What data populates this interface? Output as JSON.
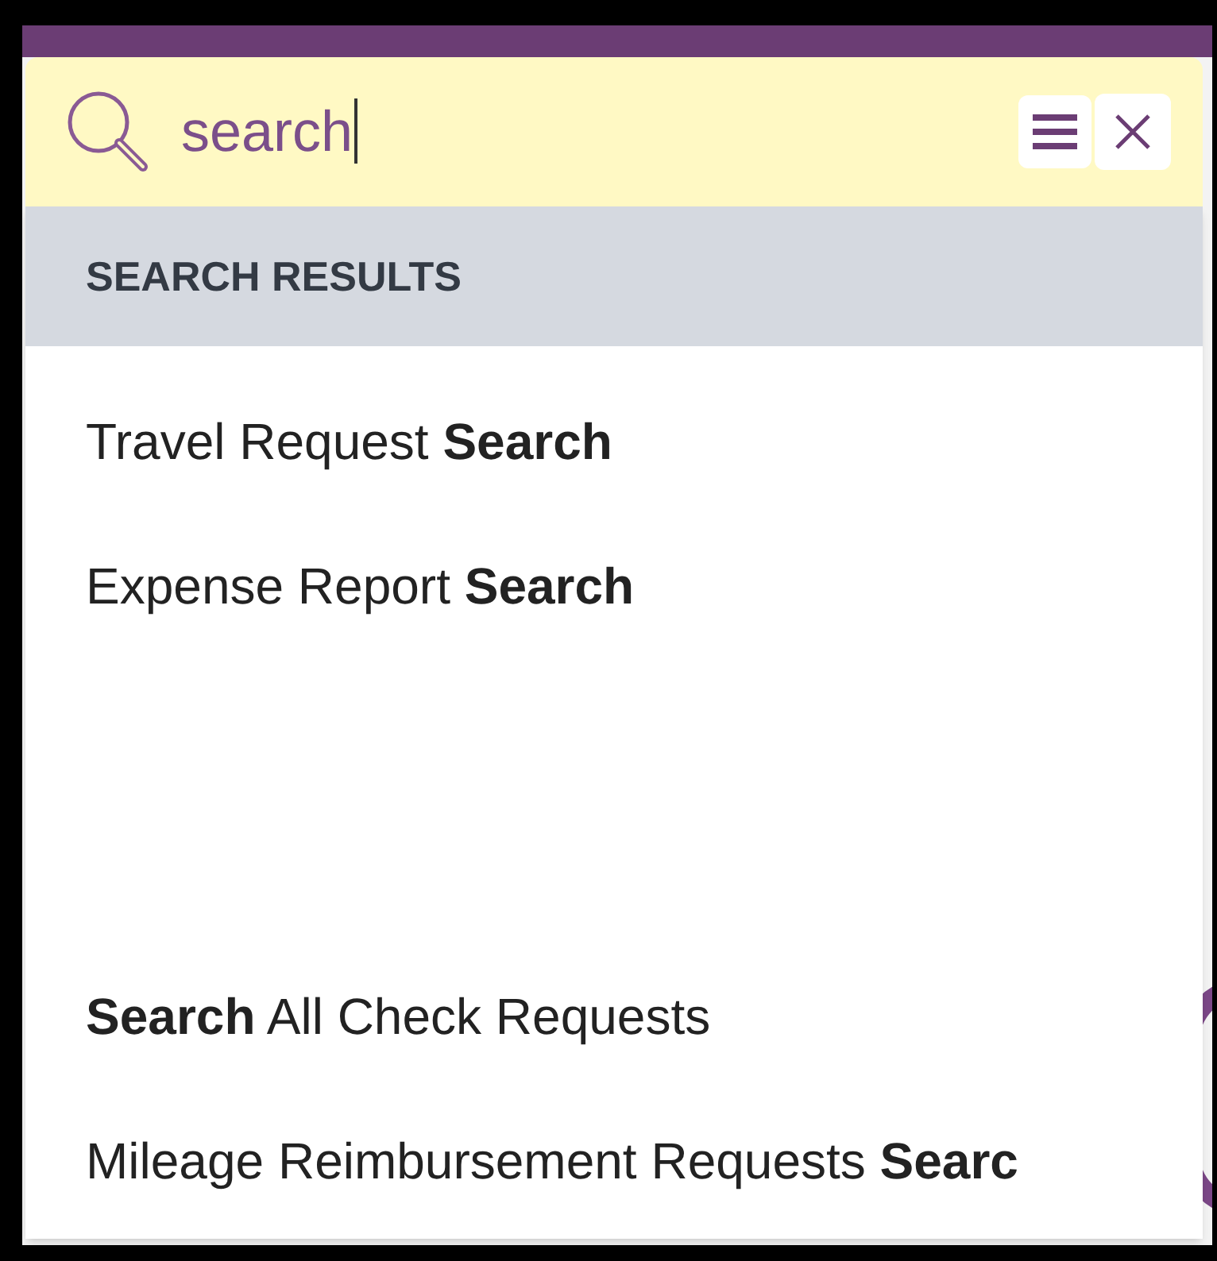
{
  "search": {
    "value": "search"
  },
  "results": {
    "heading": "SEARCH RESULTS",
    "groups": [
      {
        "items": [
          {
            "label": "Travel Request **Search**"
          },
          {
            "label": "Expense Report **Search**"
          }
        ]
      },
      {
        "items": [
          {
            "label": "**Search** All Check Requests"
          },
          {
            "label": "Mileage Reimbursement Requests **Searc**"
          }
        ]
      }
    ]
  }
}
